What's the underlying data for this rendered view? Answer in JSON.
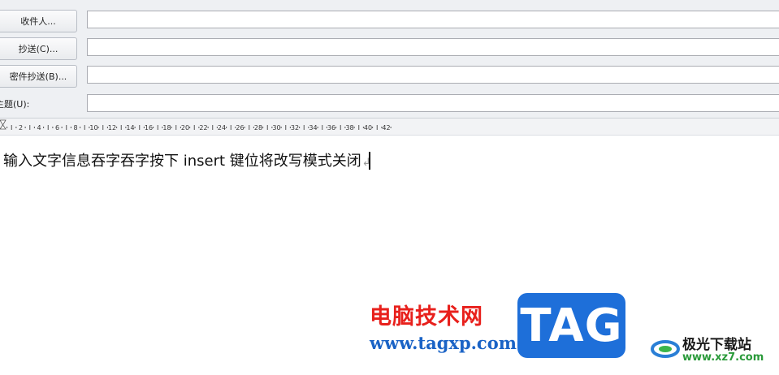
{
  "header": {
    "to_button": "收件人...",
    "cc_button": "抄送(C)...",
    "bcc_button": "密件抄送(B)...",
    "subject_label": "主题(U):",
    "to_value": "",
    "cc_value": "",
    "bcc_value": "",
    "subject_value": ""
  },
  "ruler": {
    "labels": [
      "2",
      "4",
      "6",
      "8",
      "10",
      "12",
      "14",
      "16",
      "18",
      "20",
      "22",
      "24",
      "26",
      "28",
      "30",
      "32",
      "34",
      "36",
      "38",
      "40",
      "42"
    ]
  },
  "editor": {
    "text": "输入文字信息吞字吞字按下 insert 键位将改写模式关闭",
    "paragraph_mark": "↲"
  },
  "watermark": {
    "site_name": "电脑技术网",
    "site_url": "www.tagxp.com",
    "tag_text": "TAG",
    "jiguang_name": "极光下载站",
    "jiguang_url": "www.xz7.com"
  }
}
